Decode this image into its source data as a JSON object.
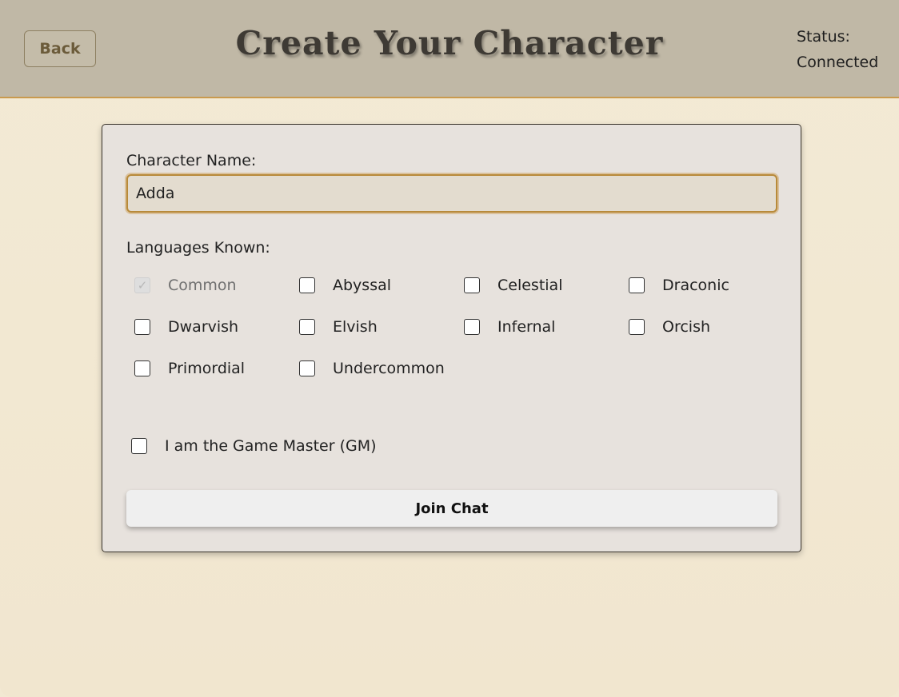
{
  "header": {
    "back_label": "Back",
    "title": "Create Your Character",
    "status_label": "Status:",
    "status_value": "Connected"
  },
  "form": {
    "name_label": "Character Name:",
    "name_value": "Adda",
    "languages_label": "Languages Known:",
    "languages": [
      {
        "label": "Common",
        "checked": true,
        "disabled": true
      },
      {
        "label": "Abyssal",
        "checked": false,
        "disabled": false
      },
      {
        "label": "Celestial",
        "checked": false,
        "disabled": false
      },
      {
        "label": "Draconic",
        "checked": false,
        "disabled": false
      },
      {
        "label": "Dwarvish",
        "checked": false,
        "disabled": false
      },
      {
        "label": "Elvish",
        "checked": false,
        "disabled": false
      },
      {
        "label": "Infernal",
        "checked": false,
        "disabled": false
      },
      {
        "label": "Orcish",
        "checked": false,
        "disabled": false
      },
      {
        "label": "Primordial",
        "checked": false,
        "disabled": false
      },
      {
        "label": "Undercommon",
        "checked": false,
        "disabled": false
      }
    ],
    "gm_label": "I am the Game Master (GM)",
    "gm_checked": false,
    "join_label": "Join Chat"
  },
  "colors": {
    "header_bg": "#c0b8a6",
    "accent": "#c99a4e",
    "page_bg": "#f2e8d2",
    "card_bg": "#e7e2dd"
  }
}
